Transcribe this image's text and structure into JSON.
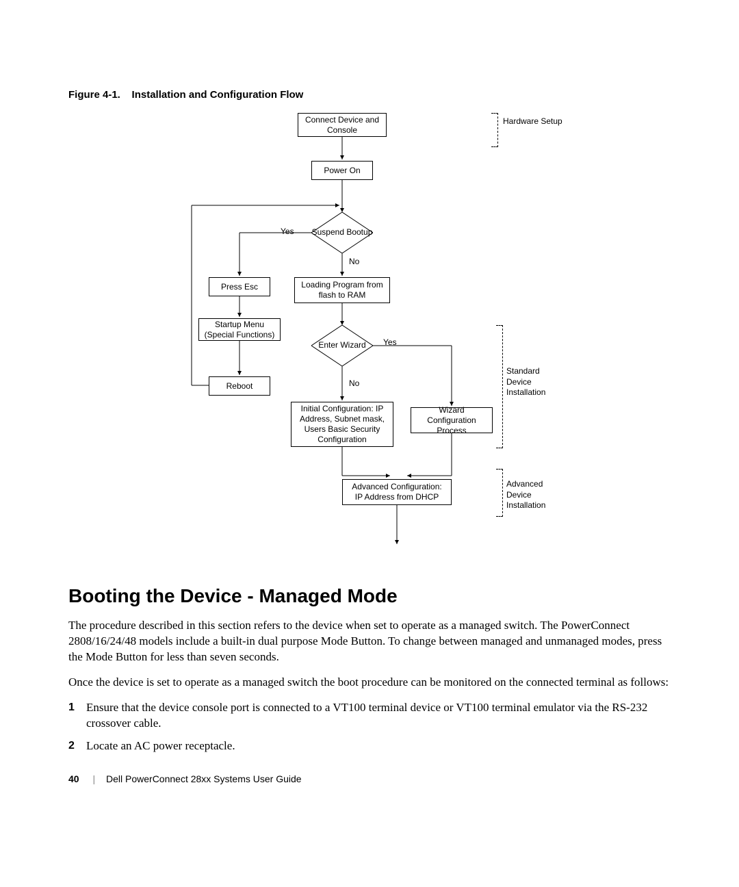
{
  "figure": {
    "caption_prefix": "Figure 4-1.",
    "caption_title": "Installation and Configuration Flow"
  },
  "flow": {
    "connect": "Connect Device and Console",
    "power_on": "Power On",
    "suspend": "Suspend Bootup",
    "yes_suspend": "Yes",
    "no_suspend": "No",
    "press_esc": "Press Esc",
    "loading": "Loading Program from flash to RAM",
    "startup_menu": "Startup Menu (Special Functions)",
    "reboot": "Reboot",
    "enter_wizard": "Enter Wizard",
    "yes_wizard": "Yes",
    "no_wizard": "No",
    "initial_config": "Initial Configuration: IP Address, Subnet mask, Users Basic Security Configuration",
    "wizard_process": "Wizard Configuration Process",
    "advanced_config": "Advanced Configuration: IP Address from DHCP",
    "bracket_hw": "Hardware Setup",
    "bracket_std": "Standard Device Installation",
    "bracket_adv": "Advanced Device Installation"
  },
  "section": {
    "heading": "Booting the Device - Managed Mode",
    "p1": "The procedure described in this section refers to the device when set to operate as a managed switch. The PowerConnect 2808/16/24/48 models include a built-in dual purpose Mode Button. To change between managed and unmanaged modes, press the Mode Button for less than seven seconds.",
    "p2": "Once the device is set to operate as a managed switch the boot procedure can be monitored on the connected terminal as follows:",
    "steps": [
      "Ensure that the device console port is connected to a VT100 terminal device or VT100 terminal emulator via the RS-232 crossover cable.",
      "Locate an AC power receptacle."
    ]
  },
  "footer": {
    "page_number": "40",
    "guide": "Dell PowerConnect 28xx Systems User Guide"
  }
}
